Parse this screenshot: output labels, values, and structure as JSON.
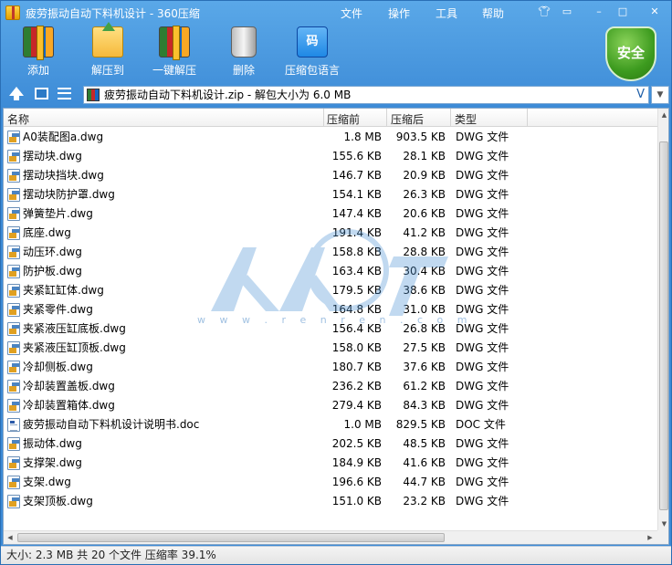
{
  "window": {
    "title": "疲劳振动自动下料机设计 - 360压缩"
  },
  "menu": [
    {
      "label": "文件"
    },
    {
      "label": "操作"
    },
    {
      "label": "工具"
    },
    {
      "label": "帮助"
    }
  ],
  "title_controls": {
    "skin_icon": "shirt-icon",
    "feedback_icon": "chat-icon",
    "min_icon": "minimize-icon",
    "max_icon": "maximize-icon",
    "close_icon": "close-icon"
  },
  "toolbar": {
    "add": "添加",
    "extract_to": "解压到",
    "one_click_extract": "一键解压",
    "delete": "删除",
    "comment": "压缩包语言",
    "comment_icon_text": "码",
    "security": "安全"
  },
  "address": {
    "value": "疲劳振动自动下料机设计.zip - 解包大小为 6.0 MB",
    "dropdown_glyph": "V"
  },
  "columns": {
    "name": "名称",
    "size": "压缩前",
    "packed": "压缩后",
    "type": "类型"
  },
  "files": [
    {
      "name": "A0装配图a.dwg",
      "size": "1.8 MB",
      "packed": "903.5 KB",
      "type": "DWG 文件",
      "icon": "dwg"
    },
    {
      "name": "摆动块.dwg",
      "size": "155.6 KB",
      "packed": "28.1 KB",
      "type": "DWG 文件",
      "icon": "dwg"
    },
    {
      "name": "摆动块挡块.dwg",
      "size": "146.7 KB",
      "packed": "20.9 KB",
      "type": "DWG 文件",
      "icon": "dwg"
    },
    {
      "name": "摆动块防护罩.dwg",
      "size": "154.1 KB",
      "packed": "26.3 KB",
      "type": "DWG 文件",
      "icon": "dwg"
    },
    {
      "name": "弹簧垫片.dwg",
      "size": "147.4 KB",
      "packed": "20.6 KB",
      "type": "DWG 文件",
      "icon": "dwg"
    },
    {
      "name": "底座.dwg",
      "size": "191.4 KB",
      "packed": "41.2 KB",
      "type": "DWG 文件",
      "icon": "dwg"
    },
    {
      "name": "动压环.dwg",
      "size": "158.8 KB",
      "packed": "28.8 KB",
      "type": "DWG 文件",
      "icon": "dwg"
    },
    {
      "name": "防护板.dwg",
      "size": "163.4 KB",
      "packed": "30.4 KB",
      "type": "DWG 文件",
      "icon": "dwg"
    },
    {
      "name": "夹紧缸缸体.dwg",
      "size": "179.5 KB",
      "packed": "38.6 KB",
      "type": "DWG 文件",
      "icon": "dwg"
    },
    {
      "name": "夹紧零件.dwg",
      "size": "164.8 KB",
      "packed": "31.0 KB",
      "type": "DWG 文件",
      "icon": "dwg"
    },
    {
      "name": "夹紧液压缸底板.dwg",
      "size": "156.4 KB",
      "packed": "26.8 KB",
      "type": "DWG 文件",
      "icon": "dwg"
    },
    {
      "name": "夹紧液压缸顶板.dwg",
      "size": "158.0 KB",
      "packed": "27.5 KB",
      "type": "DWG 文件",
      "icon": "dwg"
    },
    {
      "name": "冷却侧板.dwg",
      "size": "180.7 KB",
      "packed": "37.6 KB",
      "type": "DWG 文件",
      "icon": "dwg"
    },
    {
      "name": "冷却装置盖板.dwg",
      "size": "236.2 KB",
      "packed": "61.2 KB",
      "type": "DWG 文件",
      "icon": "dwg"
    },
    {
      "name": "冷却装置箱体.dwg",
      "size": "279.4 KB",
      "packed": "84.3 KB",
      "type": "DWG 文件",
      "icon": "dwg"
    },
    {
      "name": "疲劳振动自动下料机设计说明书.doc",
      "size": "1.0 MB",
      "packed": "829.5 KB",
      "type": "DOC 文件",
      "icon": "doc"
    },
    {
      "name": "振动体.dwg",
      "size": "202.5 KB",
      "packed": "48.5 KB",
      "type": "DWG 文件",
      "icon": "dwg"
    },
    {
      "name": "支撑架.dwg",
      "size": "184.9 KB",
      "packed": "41.6 KB",
      "type": "DWG 文件",
      "icon": "dwg"
    },
    {
      "name": "支架.dwg",
      "size": "196.6 KB",
      "packed": "44.7 KB",
      "type": "DWG 文件",
      "icon": "dwg"
    },
    {
      "name": "支架顶板.dwg",
      "size": "151.0 KB",
      "packed": "23.2 KB",
      "type": "DWG 文件",
      "icon": "dwg"
    }
  ],
  "watermark": {
    "text": "w w w . r e n r e n . c o m"
  },
  "status": {
    "text": "大小: 2.3 MB 共 20 个文件 压缩率 39.1%"
  },
  "colors": {
    "accent": "#3c8ad6",
    "shield": "#3d9b1f"
  }
}
